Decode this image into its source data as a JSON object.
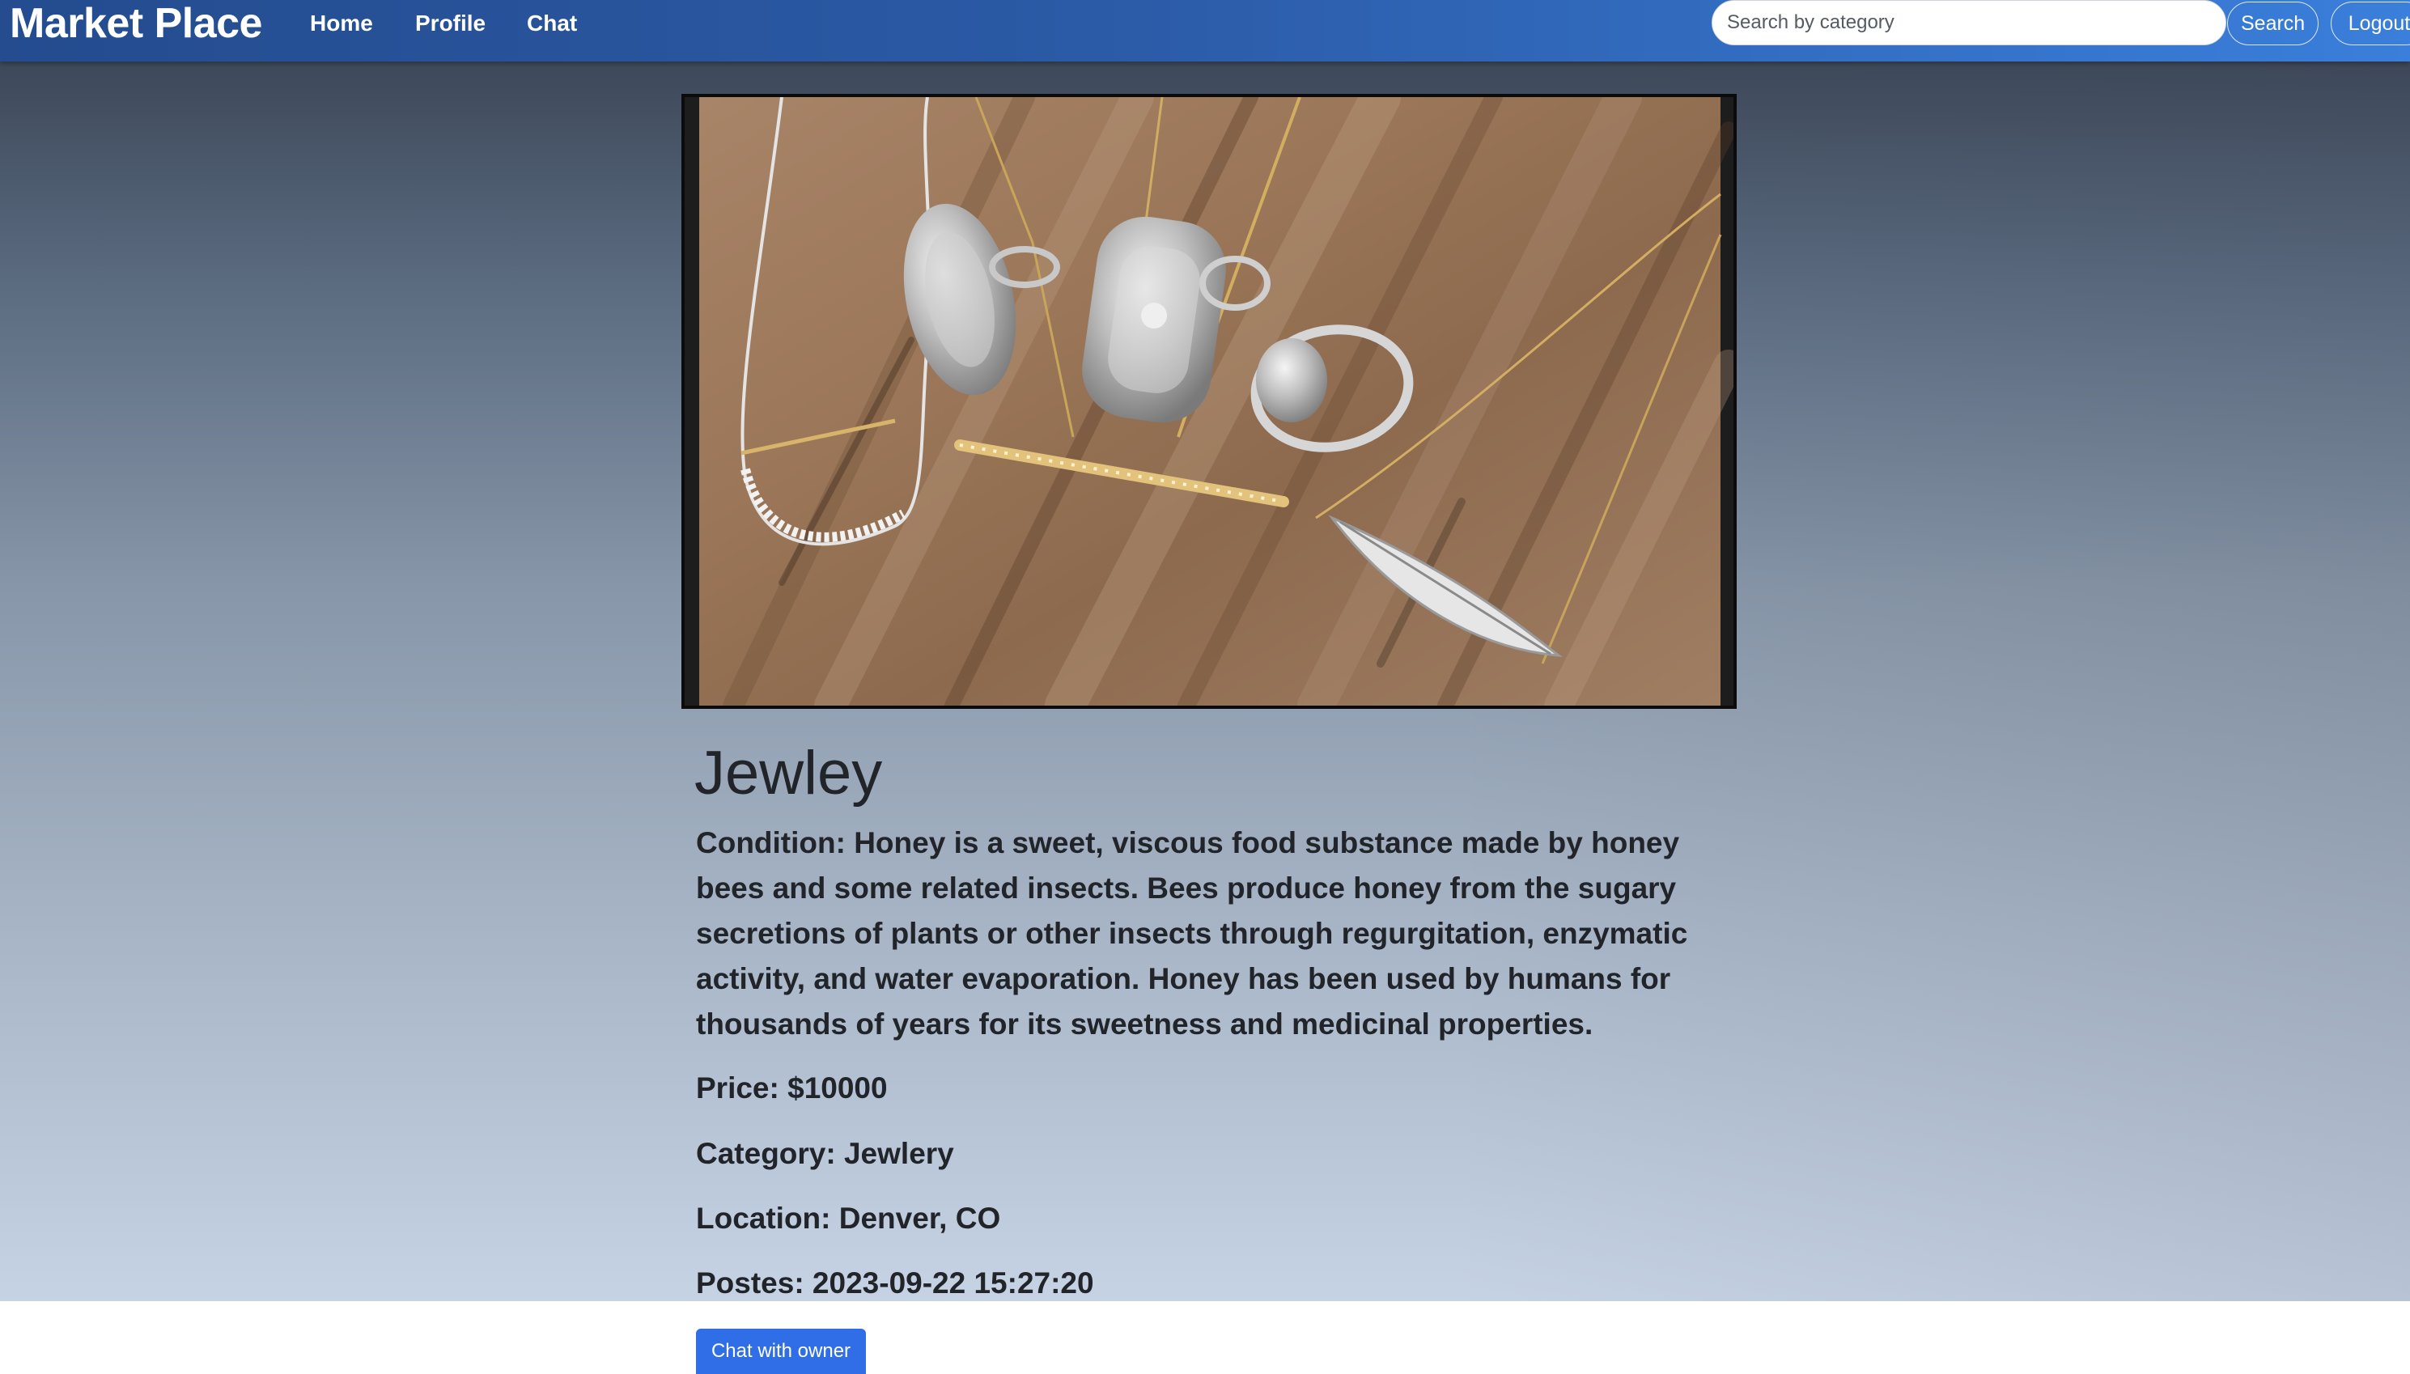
{
  "navbar": {
    "brand": "Market Place",
    "links": [
      "Home",
      "Profile",
      "Chat"
    ],
    "search_placeholder": "Search by category",
    "search_button": "Search",
    "logout_button": "Logout",
    "colors": {
      "start": "#244c8f",
      "end": "#3a7fdb"
    }
  },
  "product": {
    "image_alt": "Jewelry: silver rings and necklaces on wooden surface",
    "title": "Jewley",
    "condition": "Condition: Honey is a sweet, viscous food substance made by honey bees and some related insects. Bees produce honey from the sugary secretions of plants or other insects through regurgitation, enzymatic activity, and water evaporation. Honey has been used by humans for thousands of years for its sweetness and medicinal properties.",
    "price": "Price: $10000",
    "category": "Category: Jewlery",
    "location": "Location: Denver, CO",
    "posted": "Postes: 2023-09-22 15:27:20",
    "chat_button": "Chat with owner",
    "accent_color": "#2f6ee6"
  }
}
